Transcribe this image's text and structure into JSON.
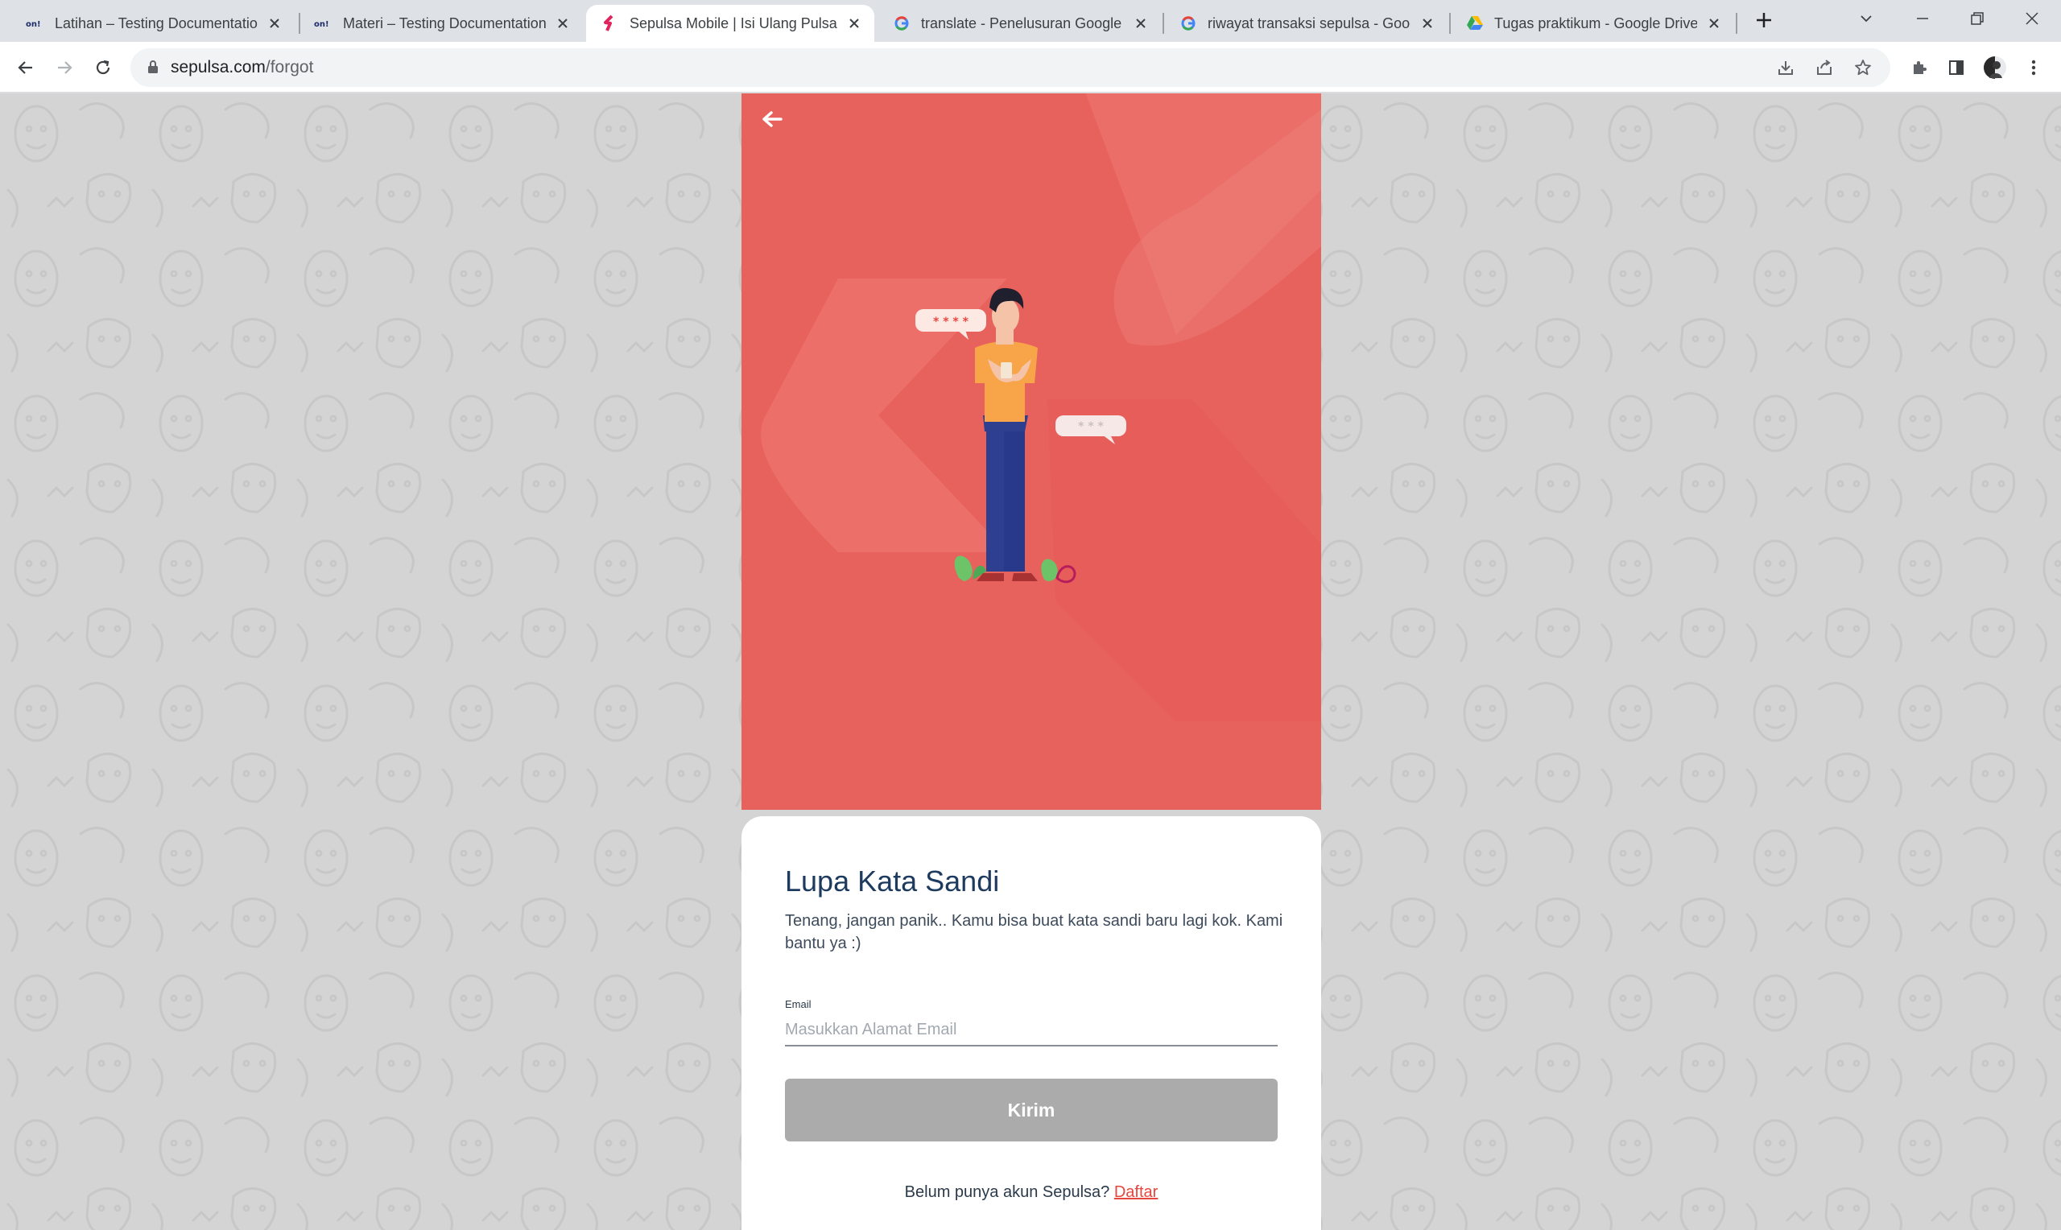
{
  "browser": {
    "tabs": [
      {
        "title": "Latihan – Testing Documentation",
        "favicon": "oneil-logo-icon",
        "active": false
      },
      {
        "title": "Materi – Testing Documentation",
        "favicon": "oneil-logo-icon",
        "active": false
      },
      {
        "title": "Sepulsa Mobile | Isi Ulang Pulsa S",
        "favicon": "sepulsa-logo-icon",
        "active": true
      },
      {
        "title": "translate - Penelusuran Google",
        "favicon": "google-icon",
        "active": false
      },
      {
        "title": "riwayat transaksi sepulsa - Googl",
        "favicon": "google-icon",
        "active": false
      },
      {
        "title": "Tugas praktikum - Google Drive",
        "favicon": "google-drive-icon",
        "active": false
      }
    ],
    "favicon_text": {
      "oneil": "on!"
    },
    "address": {
      "domain": "sepulsa.com",
      "path": "/forgot"
    }
  },
  "illustration": {
    "bubble_left": "* * * *",
    "bubble_right": "* * *"
  },
  "form": {
    "title": "Lupa Kata Sandi",
    "description": "Tenang, jangan panik.. Kamu bisa buat kata sandi baru lagi kok. Kami bantu ya :)",
    "email_label": "Email",
    "email_value": "",
    "email_placeholder": "Masukkan Alamat Email",
    "submit_label": "Kirim",
    "signup_prompt": "Belum punya akun Sepulsa?",
    "signup_link": "Daftar"
  },
  "colors": {
    "hero_background": "#e8625d",
    "title_color": "#1d3a5f",
    "link_color": "#e5473f",
    "button_disabled": "#ababab",
    "page_background": "#d4d4d4"
  }
}
